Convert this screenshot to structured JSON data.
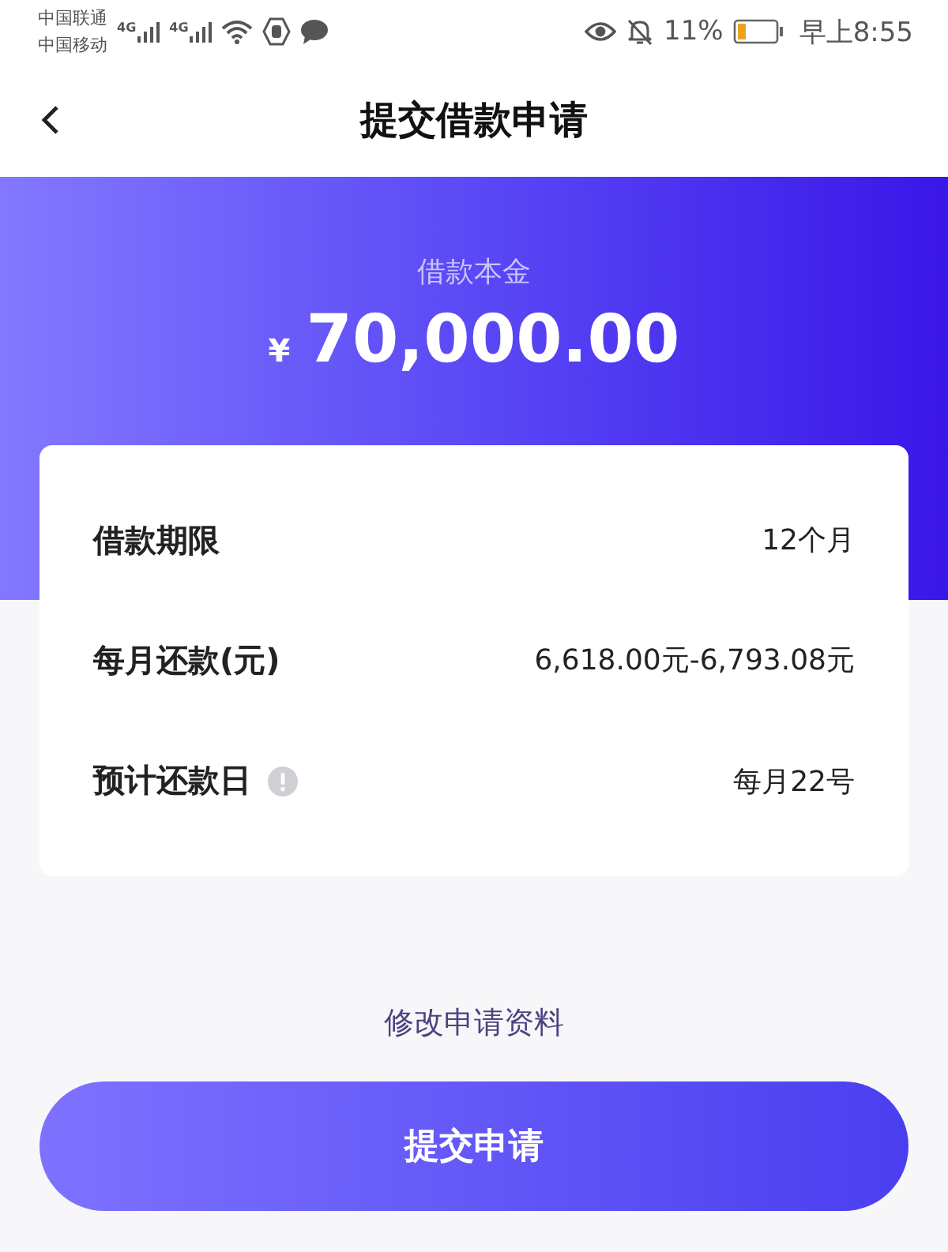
{
  "status_bar": {
    "carriers": [
      "中国联通",
      "中国移动"
    ],
    "network_labels": [
      "4G",
      "4G"
    ],
    "battery_percent": "11%",
    "time": "早上8:55"
  },
  "header": {
    "title": "提交借款申请"
  },
  "amount": {
    "label": "借款本金",
    "currency": "¥",
    "value": "70,000.00"
  },
  "details": [
    {
      "label": "借款期限",
      "value": "12个月",
      "info": false
    },
    {
      "label": "每月还款(元)",
      "value": "6,618.00元-6,793.08元",
      "info": false
    },
    {
      "label": "预计还款日",
      "value": "每月22号",
      "info": true
    }
  ],
  "edit_link": "修改申请资料",
  "submit_button": "提交申请"
}
